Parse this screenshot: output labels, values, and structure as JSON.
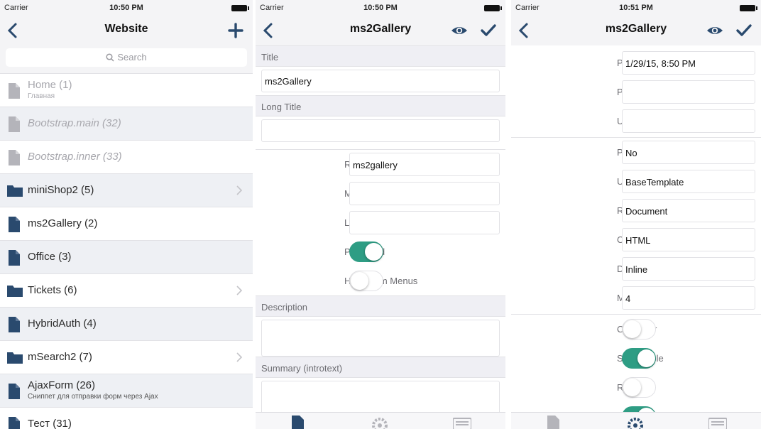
{
  "colors": {
    "accent": "#2a4a6e",
    "toggle_on": "#2e9d84",
    "section_bg": "#efeff4"
  },
  "screen1": {
    "status": {
      "carrier": "Carrier",
      "time": "10:50 PM"
    },
    "nav": {
      "title": "Website",
      "back_icon": "chevron-left-icon",
      "add_icon": "plus-icon"
    },
    "search": {
      "placeholder": "Search"
    },
    "rows": [
      {
        "label": "Home (1)",
        "sub": "Главная",
        "icon": "document-icon",
        "dim": true,
        "italic": false,
        "chevron": false,
        "shade": false
      },
      {
        "label": "Bootstrap.main (32)",
        "sub": "",
        "icon": "document-icon",
        "dim": true,
        "italic": true,
        "chevron": false,
        "shade": true
      },
      {
        "label": "Bootstrap.inner (33)",
        "sub": "",
        "icon": "document-icon",
        "dim": true,
        "italic": true,
        "chevron": false,
        "shade": false
      },
      {
        "label": "miniShop2 (5)",
        "sub": "",
        "icon": "folder-icon",
        "dim": false,
        "italic": false,
        "chevron": true,
        "shade": true
      },
      {
        "label": "ms2Gallery (2)",
        "sub": "",
        "icon": "document-icon",
        "dim": false,
        "italic": false,
        "chevron": false,
        "shade": false
      },
      {
        "label": "Office (3)",
        "sub": "",
        "icon": "document-icon",
        "dim": false,
        "italic": false,
        "chevron": false,
        "shade": true
      },
      {
        "label": "Tickets (6)",
        "sub": "",
        "icon": "folder-icon",
        "dim": false,
        "italic": false,
        "chevron": true,
        "shade": false
      },
      {
        "label": "HybridAuth (4)",
        "sub": "",
        "icon": "document-icon",
        "dim": false,
        "italic": false,
        "chevron": false,
        "shade": true
      },
      {
        "label": "mSearch2 (7)",
        "sub": "",
        "icon": "folder-icon",
        "dim": false,
        "italic": false,
        "chevron": true,
        "shade": false
      },
      {
        "label": "AjaxForm (26)",
        "sub": "Сниппет для отправки форм через Ajax",
        "icon": "document-icon",
        "dim": false,
        "italic": false,
        "chevron": false,
        "shade": true
      },
      {
        "label": "Тест (31)",
        "sub": "",
        "icon": "document-icon",
        "dim": false,
        "italic": false,
        "chevron": false,
        "shade": false
      }
    ]
  },
  "screen2": {
    "status": {
      "carrier": "Carrier",
      "time": "10:50 PM"
    },
    "nav": {
      "title": "ms2Gallery",
      "back_icon": "chevron-left-icon",
      "preview_icon": "eye-icon",
      "save_icon": "checkmark-icon"
    },
    "sections": {
      "title": "Title",
      "long_title": "Long Title",
      "description": "Description",
      "summary": "Summary (introtext)"
    },
    "title_value": "ms2Gallery",
    "long_title_value": "",
    "fields": [
      {
        "label": "Resource Alias",
        "value": "ms2gallery"
      },
      {
        "label": "Menu Title",
        "value": ""
      },
      {
        "label": "Link Attributes",
        "value": ""
      }
    ],
    "toggles": [
      {
        "label": "Published",
        "on": true
      },
      {
        "label": "Hide From Menus",
        "on": false
      }
    ],
    "tabs": [
      "document-icon",
      "gear-icon",
      "list-icon"
    ]
  },
  "screen3": {
    "status": {
      "carrier": "Carrier",
      "time": "10:51 PM"
    },
    "nav": {
      "title": "ms2Gallery",
      "back_icon": "chevron-left-icon",
      "preview_icon": "eye-icon",
      "save_icon": "checkmark-icon"
    },
    "group1": [
      {
        "label": "Published On",
        "value": "1/29/15, 8:50 PM"
      },
      {
        "label": "Publish Date",
        "value": ""
      },
      {
        "label": "Unpublish date",
        "value": ""
      }
    ],
    "group2": [
      {
        "label": "Parent",
        "value": "No"
      },
      {
        "label": "Uses Template",
        "value": "BaseTemplate"
      },
      {
        "label": "Resource Type",
        "value": "Document"
      },
      {
        "label": "Content Type",
        "value": "HTML"
      },
      {
        "label": "Disposition",
        "value": "Inline"
      },
      {
        "label": "Menu Index",
        "value": "4"
      }
    ],
    "toggles": [
      {
        "label": "Container",
        "on": false
      },
      {
        "label": "Searchable",
        "on": true
      },
      {
        "label": "Rich Text",
        "on": false
      }
    ],
    "tabs": [
      "document-icon",
      "gear-icon",
      "list-icon"
    ]
  }
}
